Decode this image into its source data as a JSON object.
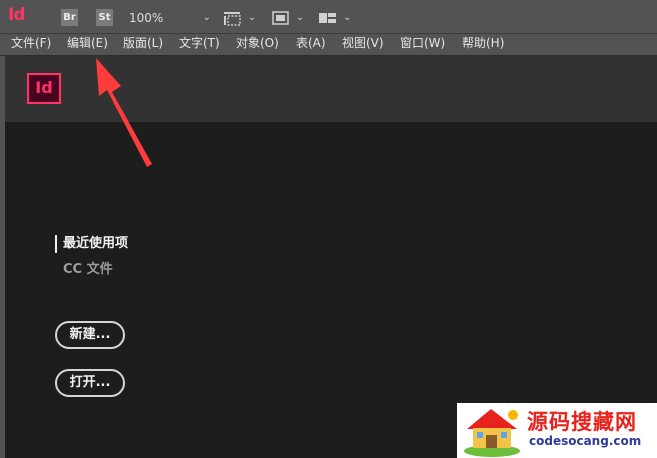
{
  "app": {
    "logo_text": "Id"
  },
  "toolbar": {
    "bridge_label": "Br",
    "stock_label": "St",
    "zoom_value": "100%",
    "chevron": "⌄"
  },
  "menu": {
    "items": [
      "文件(F)",
      "编辑(E)",
      "版面(L)",
      "文字(T)",
      "对象(O)",
      "表(A)",
      "视图(V)",
      "窗口(W)",
      "帮助(H)"
    ]
  },
  "home": {
    "badge": "Id",
    "nav_recent": "最近使用项",
    "nav_cc": "CC 文件",
    "new_button": "新建...",
    "open_button": "打开..."
  },
  "annotation": {
    "color": "#ff3b3b",
    "points_to": "编辑(E)"
  },
  "watermark": {
    "title": "源码搜藏网",
    "url": "codesocang.com",
    "colors": {
      "title": "#e8231e",
      "url": "#2f3a9c"
    }
  }
}
